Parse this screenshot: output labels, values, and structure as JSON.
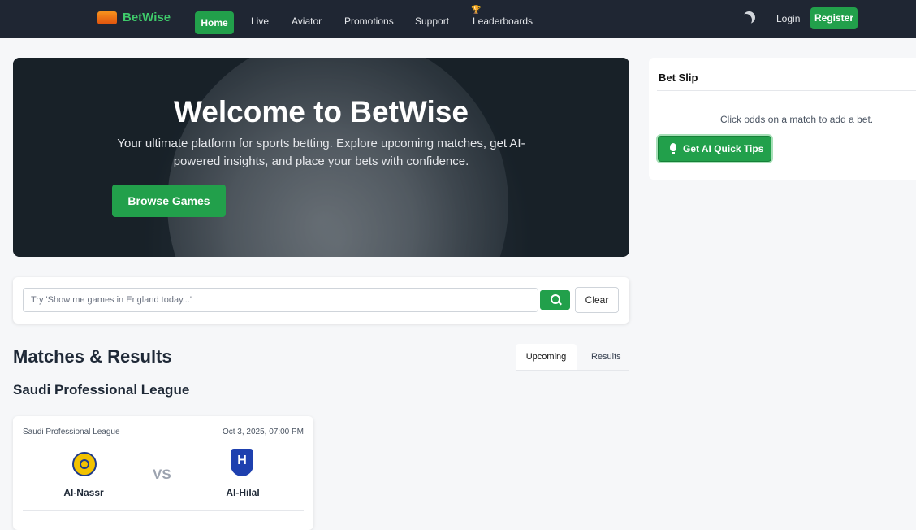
{
  "nav": {
    "logo_badge": "SPORT ZONE",
    "brand": "BetWise",
    "items": [
      "Home",
      "Live",
      "Aviator",
      "Promotions",
      "Support",
      "Leaderboards"
    ],
    "login": "Login",
    "register": "Register"
  },
  "hero": {
    "title": "Welcome to BetWise",
    "subtitle": "Your ultimate platform for sports betting. Explore upcoming matches, get AI-powered insights, and place your bets with confidence.",
    "cta": "Browse Games"
  },
  "search": {
    "placeholder": "Try 'Show me games in England today...'",
    "clear_label": "Clear"
  },
  "matches": {
    "title": "Matches & Results",
    "tabs": [
      "Upcoming",
      "Results"
    ],
    "league_title": "Saudi Professional League",
    "cards": [
      {
        "league": "Saudi Professional League",
        "date": "Oct 3, 2025, 07:00 PM",
        "home": "Al-Nassr",
        "away": "Al-Hilal",
        "vs": "VS"
      }
    ]
  },
  "betslip": {
    "title": "Bet Slip",
    "empty_text": "Click odds on a match to add a bet.",
    "tips_label": "Get AI Quick Tips"
  },
  "colors": {
    "accent": "#22a04b",
    "navbar": "#1f2633",
    "brand_text": "#3fca6b"
  }
}
